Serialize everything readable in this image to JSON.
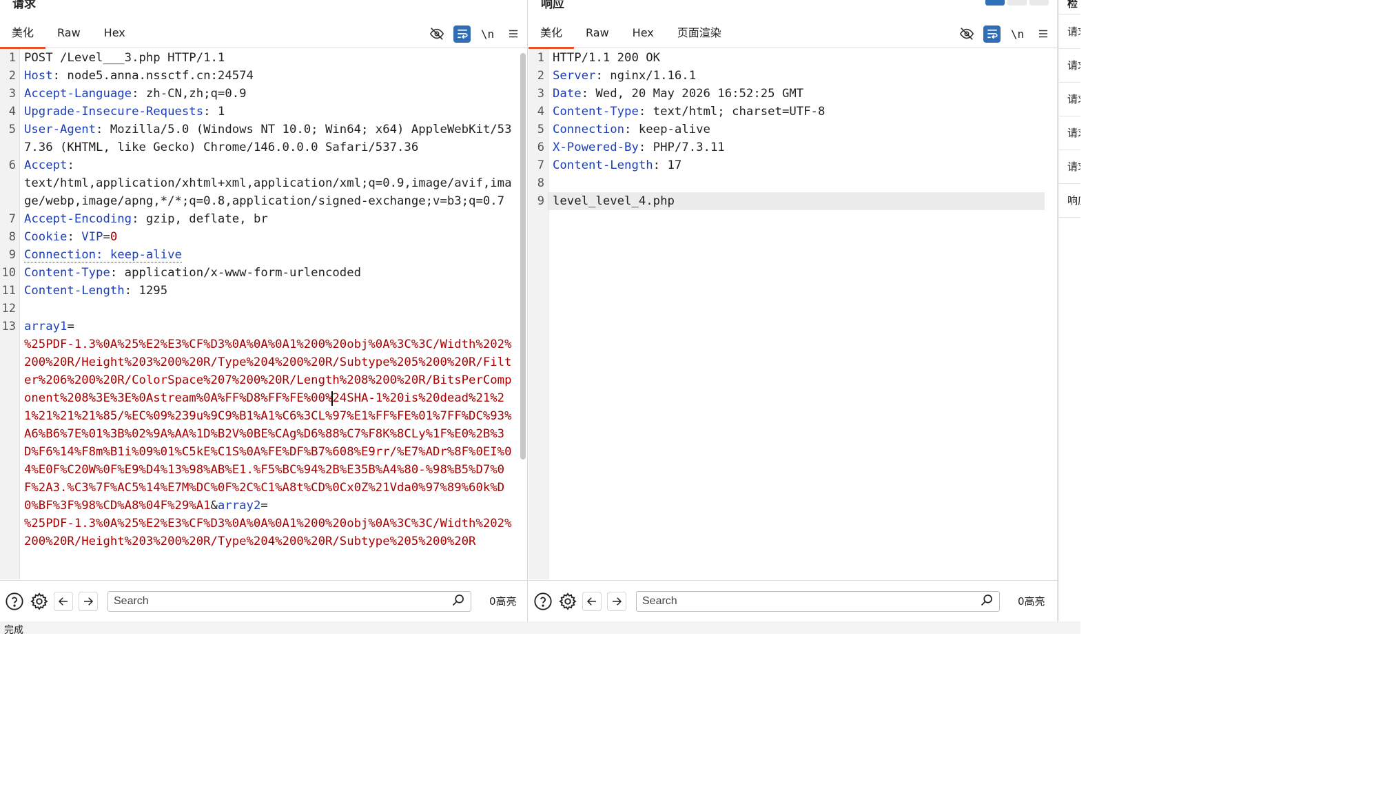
{
  "request": {
    "title": "请求",
    "tabs": [
      "美化",
      "Raw",
      "Hex"
    ],
    "active_tab": "美化",
    "toolbar": {
      "newline_label": "\\n"
    },
    "search": {
      "placeholder": "Search"
    },
    "highlight_count": "0高亮",
    "lines": [
      {
        "n": "1",
        "segs": [
          {
            "t": "POST /Level___3.php HTTP/1.1",
            "c": "hv"
          }
        ]
      },
      {
        "n": "2",
        "segs": [
          {
            "t": "Host",
            "c": "hk"
          },
          {
            "t": ": node5.anna.nssctf.cn:24574",
            "c": "hv"
          }
        ]
      },
      {
        "n": "3",
        "segs": [
          {
            "t": "Accept-Language",
            "c": "hk"
          },
          {
            "t": ": zh-CN,zh;q=0.9",
            "c": "hv"
          }
        ]
      },
      {
        "n": "4",
        "segs": [
          {
            "t": "Upgrade-Insecure-Requests",
            "c": "hk"
          },
          {
            "t": ": 1",
            "c": "hv"
          }
        ]
      },
      {
        "n": "5",
        "segs": [
          {
            "t": "User-Agent",
            "c": "hk"
          },
          {
            "t": ": Mozilla/5.0 (Windows NT 10.0; Win64; x64) AppleWebKit/537.36 (KHTML, like Gecko) Chrome/146.0.0.0 Safari/537.36",
            "c": "hv"
          }
        ]
      },
      {
        "n": "6",
        "segs": [
          {
            "t": "Accept",
            "c": "hk"
          },
          {
            "t": ":\ntext/html,application/xhtml+xml,application/xml;q=0.9,image/avif,image/webp,image/apng,*/*;q=0.8,application/signed-exchange;v=b3;q=0.7",
            "c": "hv"
          }
        ]
      },
      {
        "n": "7",
        "segs": [
          {
            "t": "Accept-Encoding",
            "c": "hk"
          },
          {
            "t": ": gzip, deflate, br",
            "c": "hv"
          }
        ]
      },
      {
        "n": "8",
        "segs": [
          {
            "t": "Cookie",
            "c": "hk"
          },
          {
            "t": ": ",
            "c": "hv"
          },
          {
            "t": "VIP",
            "c": "hk"
          },
          {
            "t": "=",
            "c": "hv"
          },
          {
            "t": "0",
            "c": "pv"
          }
        ]
      },
      {
        "n": "9",
        "segs": [
          {
            "t": "Connection: keep-alive",
            "c": "hk under"
          }
        ]
      },
      {
        "n": "10",
        "segs": [
          {
            "t": "Content-Type",
            "c": "hk"
          },
          {
            "t": ": application/x-www-form-urlencoded",
            "c": "hv"
          }
        ]
      },
      {
        "n": "11",
        "segs": [
          {
            "t": "Content-Length",
            "c": "hk"
          },
          {
            "t": ": 1295",
            "c": "hv"
          }
        ]
      },
      {
        "n": "12",
        "segs": []
      },
      {
        "n": "13",
        "segs": [
          {
            "t": "array1",
            "c": "hk"
          },
          {
            "t": "=\n",
            "c": "hv"
          },
          {
            "t": "%25PDF-1.3%0A%25%E2%E3%CF%D3%0A%0A%0A1%200%20obj%0A%3C%3C/Width%202%200%20R/Height%203%200%20R/Type%204%200%20R/Subtype%205%200%20R/Filter%206%200%20R/ColorSpace%207%200%20R/Length%208%200%20R/BitsPerComponent%208%3E%3E%0Astream%0A%FF%D8%FF%FE%00%",
            "c": "pv"
          },
          {
            "t": "",
            "c": "cursor"
          },
          {
            "t": "24SHA-1%20is%20dead%21%21%21%21%21%85/%EC%09%239u%9C9%B1%A1%C6%3CL%97%E1%FF%FE%01%7FF%DC%93%A6%B6%7E%01%3B%02%9A%AA%1D%B2V%0BE%CAg%D6%88%C7%F8K%8CLy%1F%E0%2B%3D%F6%14%F8m%B1i%09%01%C5kE%C1S%0A%FE%DF%B7%608%E9rr/%E7%ADr%8F%0EI%04%E0F%C20W%0F%E9%D4%13%98%AB%E1.%F5%BC%94%2B%E35B%A4%80-%98%B5%D7%0F%2A3.%C3%7F%AC5%14%E7M%DC%0F%2C%C1%A8t%CD%0Cx0Z%21Vda0%97%89%60k%D0%BF%3F%98%CD%A8%04F%29%A1",
            "c": "pv"
          },
          {
            "t": "&",
            "c": "hv"
          },
          {
            "t": "array2",
            "c": "hk"
          },
          {
            "t": "=\n",
            "c": "hv"
          },
          {
            "t": "%25PDF-1.3%0A%25%E2%E3%CF%D3%0A%0A%0A1%200%20obj%0A%3C%3C/Width%202%200%20R/Height%203%200%20R/Type%204%200%20R/Subtype%205%200%20R",
            "c": "pv"
          }
        ]
      }
    ]
  },
  "response": {
    "title": "响应",
    "tabs": [
      "美化",
      "Raw",
      "Hex",
      "页面渲染"
    ],
    "active_tab": "美化",
    "toolbar": {
      "newline_label": "\\n"
    },
    "search": {
      "placeholder": "Search"
    },
    "highlight_count": "0高亮",
    "lines": [
      {
        "n": "1",
        "segs": [
          {
            "t": "HTTP/1.1 200 OK",
            "c": "hv"
          }
        ]
      },
      {
        "n": "2",
        "segs": [
          {
            "t": "Server",
            "c": "hk"
          },
          {
            "t": ": nginx/1.16.1",
            "c": "hv"
          }
        ]
      },
      {
        "n": "3",
        "segs": [
          {
            "t": "Date",
            "c": "hk"
          },
          {
            "t": ": Wed, 20 May 2026 16:52:25 GMT",
            "c": "hv"
          }
        ]
      },
      {
        "n": "4",
        "segs": [
          {
            "t": "Content-Type",
            "c": "hk"
          },
          {
            "t": ": text/html; charset=UTF-8",
            "c": "hv"
          }
        ]
      },
      {
        "n": "5",
        "segs": [
          {
            "t": "Connection",
            "c": "hk"
          },
          {
            "t": ": keep-alive",
            "c": "hv"
          }
        ]
      },
      {
        "n": "6",
        "segs": [
          {
            "t": "X-Powered-By",
            "c": "hk"
          },
          {
            "t": ": PHP/7.3.11",
            "c": "hv"
          }
        ]
      },
      {
        "n": "7",
        "segs": [
          {
            "t": "Content-Length",
            "c": "hk"
          },
          {
            "t": ": 17",
            "c": "hv"
          }
        ]
      },
      {
        "n": "8",
        "segs": []
      },
      {
        "n": "9",
        "segs": [
          {
            "t": "level_level_4.php",
            "c": "hv"
          }
        ],
        "highlight": true
      }
    ]
  },
  "side_panel": {
    "top_label": "检",
    "items": [
      "请求",
      "请求",
      "请求",
      "请求",
      "请求",
      "响应"
    ]
  },
  "status_bar": {
    "text": "完成"
  },
  "colors": {
    "header_key": "#1c3fb8",
    "param_value": "#aa0000",
    "active_tab_underline": "#e8512a",
    "toggle_active": "#2f6db6"
  }
}
